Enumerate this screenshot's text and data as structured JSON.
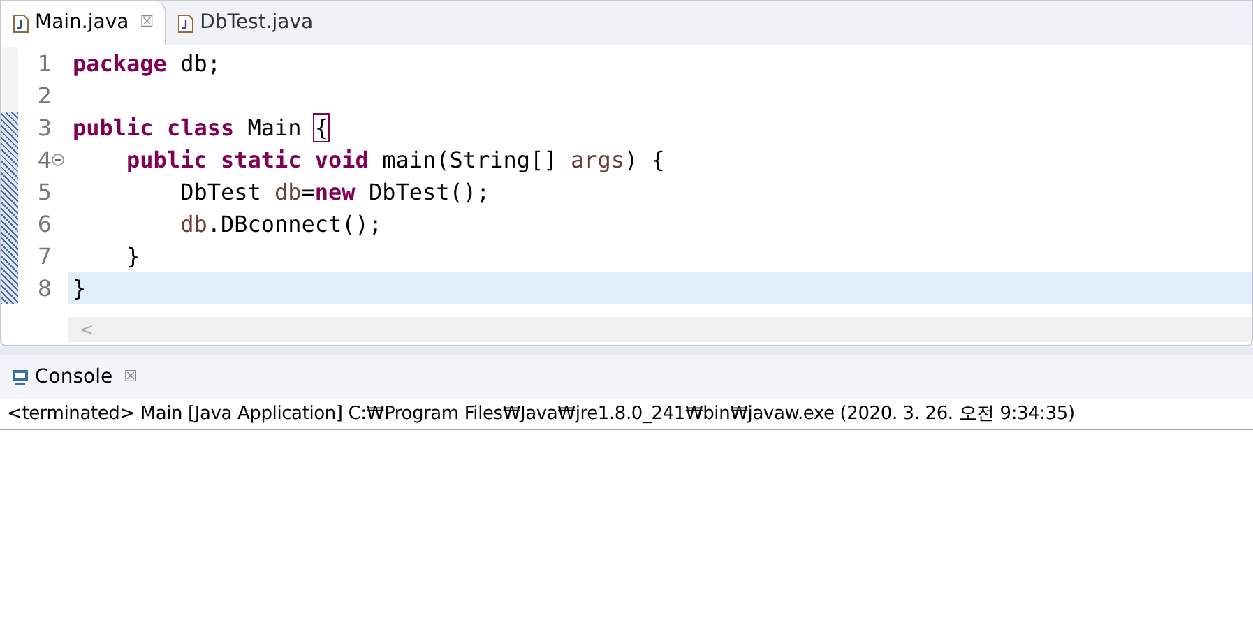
{
  "editor_tabs": [
    {
      "label": "Main.java",
      "selected": true,
      "close": "☒"
    },
    {
      "label": "DbTest.java",
      "selected": false
    }
  ],
  "code_lines": [
    {
      "number": "1",
      "current": false,
      "fold": false,
      "tokens": [
        {
          "kind": "keyword",
          "text": "package "
        },
        {
          "kind": "plain",
          "text": "db;"
        }
      ]
    },
    {
      "number": "2",
      "current": false,
      "fold": false
    },
    {
      "number": "3",
      "current": false,
      "fold": false,
      "tokens": [
        {
          "kind": "keyword",
          "text": "public "
        },
        {
          "kind": "keyword",
          "text": "class "
        },
        {
          "kind": "plain",
          "text": "Main "
        },
        {
          "kind": "bracket",
          "text": "{"
        }
      ]
    },
    {
      "number": "4",
      "current": false,
      "fold": true,
      "tokens": [
        {
          "kind": "keyword",
          "text": "    public "
        },
        {
          "kind": "keyword",
          "text": "static "
        },
        {
          "kind": "keyword",
          "text": "void "
        },
        {
          "kind": "plain",
          "text": "main(String[] "
        },
        {
          "kind": "variable",
          "text": "args"
        },
        {
          "kind": "plain",
          "text": ") {"
        }
      ]
    },
    {
      "number": "5",
      "current": false,
      "fold": false,
      "tokens": [
        {
          "kind": "plain",
          "text": "        DbTest "
        },
        {
          "kind": "variable",
          "text": "db"
        },
        {
          "kind": "plain",
          "text": "="
        },
        {
          "kind": "keyword",
          "text": "new"
        },
        {
          "kind": "plain",
          "text": " DbTest();"
        }
      ]
    },
    {
      "number": "6",
      "current": false,
      "fold": false,
      "tokens": [
        {
          "kind": "variable",
          "text": "        db"
        },
        {
          "kind": "plain",
          "text": ".DBconnect();"
        }
      ]
    },
    {
      "number": "7",
      "current": false,
      "fold": false,
      "tokens": [
        {
          "kind": "plain",
          "text": "    }"
        }
      ]
    },
    {
      "number": "8",
      "current": true,
      "fold": false,
      "tokens": [
        {
          "kind": "plain",
          "text": "}"
        }
      ]
    }
  ],
  "scroll_left": "<",
  "console": {
    "tab": {
      "label": "Console",
      "close": "☒"
    },
    "status": "<terminated> Main [Java Application] C:₩Program Files₩Java₩jre1.8.0_241₩bin₩javaw.exe (2020. 3. 26. 오전 9:34:35)"
  }
}
